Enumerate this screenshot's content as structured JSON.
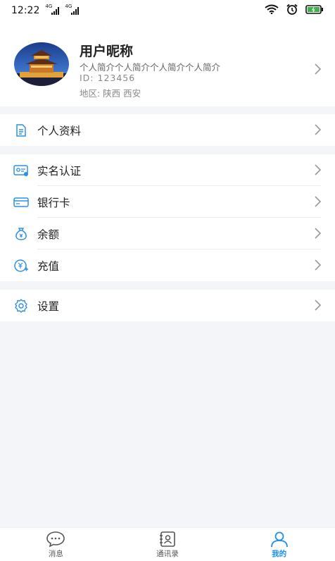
{
  "status_bar": {
    "time": "12:22",
    "network1": "4G",
    "network2": "4G",
    "battery": "battery-icon"
  },
  "profile": {
    "nickname": "用户昵称",
    "bio": "个人简介个人简介个人简介个人简介",
    "id": "ID: 123456",
    "region": "地区: 陕西  西安"
  },
  "menu": {
    "personal_info": "个人资料",
    "real_name": "实名认证",
    "bank_card": "银行卡",
    "balance": "余额",
    "recharge": "充值",
    "settings": "设置"
  },
  "tabs": [
    {
      "label": "消息",
      "icon": "message-icon"
    },
    {
      "label": "通讯录",
      "icon": "contacts-icon"
    },
    {
      "label": "我的",
      "icon": "user-icon"
    }
  ],
  "colors": {
    "accent": "#1a8ff0",
    "icon_blue": "#2e8fe6",
    "background": "#f3f5f9"
  }
}
